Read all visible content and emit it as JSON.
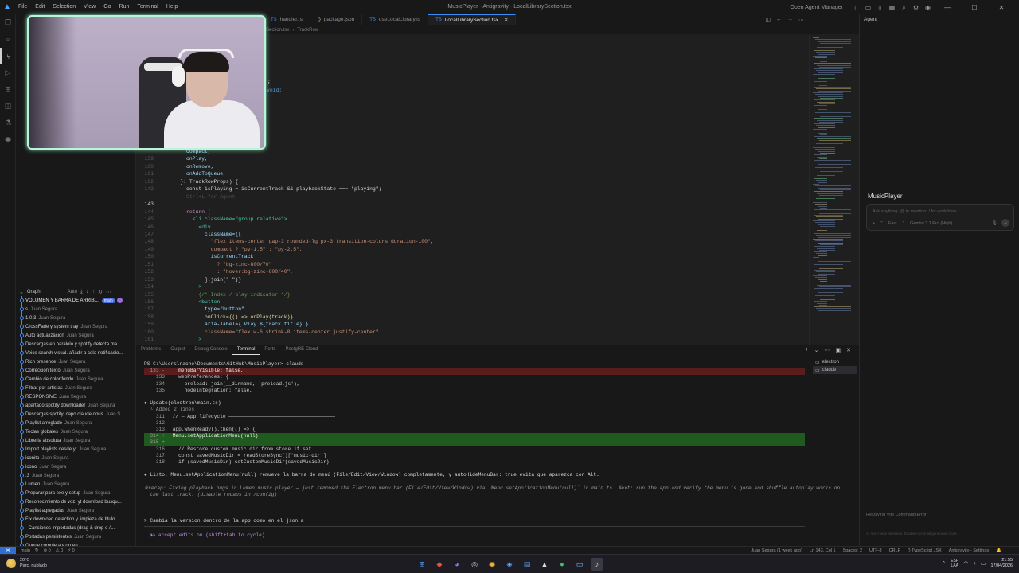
{
  "window": {
    "title": "MusicPlayer - Antigravity - LocalLibrarySection.tsx",
    "menu": [
      "File",
      "Edit",
      "Selection",
      "View",
      "Go",
      "Run",
      "Terminal",
      "Help"
    ],
    "open_agent_manager": "Open Agent Manager"
  },
  "tabs": [
    {
      "label": "handler.ts",
      "icon": "ts-icon",
      "active": false
    },
    {
      "label": "package.json",
      "icon": "json-icon",
      "active": false
    },
    {
      "label": "useLocalLibrary.ts",
      "icon": "ts-icon",
      "active": false
    },
    {
      "label": "LocalLibrarySection.tsx",
      "icon": "tsx-icon",
      "active": true
    }
  ],
  "breadcrumb": {
    "file": "ySection.tsx",
    "symbol": "TrackRow"
  },
  "editor": {
    "lines": [
      {
        "n": "",
        "t": "compact,",
        "cls": "tk-var",
        "indent": 6
      },
      {
        "n": "159",
        "t": "onPlay,",
        "cls": "tk-var",
        "indent": 6
      },
      {
        "n": "160",
        "t": "onRemove,",
        "cls": "tk-var",
        "indent": 6
      },
      {
        "n": "161",
        "t": "onAddToQueue,",
        "cls": "tk-var",
        "indent": 6
      },
      {
        "n": "162",
        "t": "}: TrackRowProps) {",
        "cls": "tk-txt",
        "indent": 4
      },
      {
        "n": "142",
        "t": "const isPlaying = isCurrentTrack && playbackState === \"playing\";",
        "cls": "tk-txt",
        "indent": 6
      },
      {
        "n": "",
        "t": "Ctrl+L for Agent",
        "cls": "tk-hint",
        "indent": 6
      },
      {
        "n": "143",
        "t": "",
        "cls": "tk-txt",
        "indent": 6,
        "cur": true
      },
      {
        "n": "144",
        "t": "return (",
        "cls": "tk-kw",
        "indent": 6
      },
      {
        "n": "145",
        "t": "<li className=\"group relative\">",
        "cls": "tk-tag",
        "indent": 8
      },
      {
        "n": "146",
        "t": "<div",
        "cls": "tk-tag",
        "indent": 10
      },
      {
        "n": "147",
        "t": "className={[",
        "cls": "tk-var",
        "indent": 12
      },
      {
        "n": "148",
        "t": "\"flex items-center gap-3 rounded-lg px-3 transition-colors duration-100\",",
        "cls": "tk-str",
        "indent": 14
      },
      {
        "n": "149",
        "t": "compact ? \"py-1.5\" : \"py-2.5\",",
        "cls": "tk-str",
        "indent": 14
      },
      {
        "n": "150",
        "t": "isCurrentTrack",
        "cls": "tk-var",
        "indent": 14
      },
      {
        "n": "151",
        "t": "? \"bg-zinc-800/70\"",
        "cls": "tk-str",
        "indent": 16
      },
      {
        "n": "152",
        "t": ": \"hover:bg-zinc-800/40\",",
        "cls": "tk-str",
        "indent": 16
      },
      {
        "n": "153",
        "t": "].join(\" \")}",
        "cls": "tk-txt",
        "indent": 12
      },
      {
        "n": "154",
        "t": ">",
        "cls": "tk-tag",
        "indent": 10
      },
      {
        "n": "155",
        "t": "{/* Index / play indicator */}",
        "cls": "tk-com",
        "indent": 10
      },
      {
        "n": "156",
        "t": "<button",
        "cls": "tk-tag",
        "indent": 10
      },
      {
        "n": "157",
        "t": "type=\"button\"",
        "cls": "tk-var",
        "indent": 12
      },
      {
        "n": "158",
        "t": "onClick={() => onPlay(track)}",
        "cls": "tk-fn",
        "indent": 12
      },
      {
        "n": "159",
        "t": "aria-label={`Play ${track.title}`}",
        "cls": "tk-var",
        "indent": 12
      },
      {
        "n": "160",
        "t": "className=\"flex w-6 shrink-0 items-center justify-center\"",
        "cls": "tk-str",
        "indent": 12
      },
      {
        "n": "161",
        "t": ">",
        "cls": "tk-tag",
        "indent": 10
      },
      {
        "n": "162",
        "t": "{isCurrentTrack ? (",
        "cls": "tk-txt",
        "indent": 12
      }
    ],
    "partial_top": [
      ";",
      "void;"
    ]
  },
  "sidebar": {
    "graph_title": "Graph",
    "graph_mode": "Auto",
    "commits": [
      {
        "msg": "VOLUMEN Y BARRA DE ARRIB...",
        "auth": "",
        "badge": "main"
      },
      {
        "msg": "s",
        "auth": "Juan Segura"
      },
      {
        "msg": "1.0.3",
        "auth": "Juan Segura"
      },
      {
        "msg": "CrossFade y system tray",
        "auth": "Juan Segura"
      },
      {
        "msg": "Auto actualizacion",
        "auth": "Juan Segura"
      },
      {
        "msg": "Descargas en paralelo y spotify detecta ma...",
        "auth": ""
      },
      {
        "msg": "Voice search visual. añadir a cola notificacio...",
        "auth": ""
      },
      {
        "msg": "Rich presence",
        "auth": "Juan Segura"
      },
      {
        "msg": "Correccion texto",
        "auth": "Juan Segura"
      },
      {
        "msg": "Cambio de color fondo",
        "auth": "Juan Segura"
      },
      {
        "msg": "Filtrar por artistas",
        "auth": "Juan Segura"
      },
      {
        "msg": "RESPONSIVE",
        "auth": "Juan Segura"
      },
      {
        "msg": "apartado spotify downloader",
        "auth": "Juan Segura"
      },
      {
        "msg": "Descargas spotify, capo claude opus",
        "auth": "Juan S..."
      },
      {
        "msg": "Playlist arreglado",
        "auth": "Juan Segura"
      },
      {
        "msg": "Teclas globales",
        "auth": "Juan Segura"
      },
      {
        "msg": "Libreria absoluta",
        "auth": "Juan Segura"
      },
      {
        "msg": "Import playlists desde yt",
        "auth": "Juan Segura"
      },
      {
        "msg": "iconito",
        "auth": "Juan Segura"
      },
      {
        "msg": "icono",
        "auth": "Juan Segura"
      },
      {
        "msg": ":3",
        "auth": "Juan Segura"
      },
      {
        "msg": "Lumen",
        "auth": "Juan Segura"
      },
      {
        "msg": "Preparar para exe y setup",
        "auth": "Juan Segura"
      },
      {
        "msg": "Reconocimiento de voz, yt download busqu...",
        "auth": ""
      },
      {
        "msg": "Playlist agregadas",
        "auth": "Juan Segura"
      },
      {
        "msg": "Fix download detection y limpieza de titulo...",
        "auth": ""
      },
      {
        "msg": "- Canciones importadas (drag & drop o A...",
        "auth": ""
      },
      {
        "msg": "Portadas persistentes",
        "auth": "Juan Segura"
      },
      {
        "msg": "Queue completa y orden ...",
        "auth": ""
      }
    ]
  },
  "panel": {
    "tabs": [
      "Problems",
      "Output",
      "Debug Console",
      "Terminal",
      "Ports",
      "PostgRE Cloud"
    ],
    "active_tab": "Terminal",
    "terminals": [
      "electron",
      "claude"
    ],
    "lines": [
      {
        "kind": "cmd",
        "n": "",
        "t": "PS C:\\Users\\nacho\\Documents\\GitHub\\MusicPlayer> claude"
      },
      {
        "kind": "del",
        "n": "133 -",
        "t": "   menuBarVisible: false,"
      },
      {
        "kind": "ctx",
        "n": "133",
        "t": "   webPreferences: {"
      },
      {
        "kind": "ctx",
        "n": "134",
        "t": "     preload: join(__dirname, 'preload.js'),"
      },
      {
        "kind": "ctx",
        "n": "135",
        "t": "     nodeIntegration: false,"
      },
      {
        "kind": "blank",
        "n": "",
        "t": ""
      },
      {
        "kind": "head",
        "n": "",
        "t": "● Update(electron\\main.ts)"
      },
      {
        "kind": "sub",
        "n": "",
        "t": "  └ Added 2 lines"
      },
      {
        "kind": "ctx",
        "n": "311",
        "t": " // — App lifecycle ————————————————————————————————————"
      },
      {
        "kind": "ctx",
        "n": "312",
        "t": ""
      },
      {
        "kind": "ctx",
        "n": "313",
        "t": " app.whenReady().then(() => {"
      },
      {
        "kind": "add",
        "n": "314 +",
        "t": " Menu.setApplicationMenu(null)"
      },
      {
        "kind": "add",
        "n": "315 +",
        "t": ""
      },
      {
        "kind": "ctx",
        "n": "316",
        "t": "   // Restore custom music dir from store if set"
      },
      {
        "kind": "ctx",
        "n": "317",
        "t": "   const savedMusicDir = readStoreSync()['music-dir']"
      },
      {
        "kind": "ctx",
        "n": "318",
        "t": "   if (savedMusicDir) setCustomMusicDir(savedMusicDir)"
      },
      {
        "kind": "blank",
        "n": "",
        "t": ""
      },
      {
        "kind": "head",
        "n": "",
        "t": "● Listo. Menu.setApplicationMenu(null) remueve la barra de menú (File/Edit/View/Window) completamente, y autoHideMenuBar: true evita que aparezca con Alt."
      },
      {
        "kind": "blank",
        "n": "",
        "t": ""
      },
      {
        "kind": "recap",
        "n": "",
        "t": "※recap: Fixing playback bugs in Lumen music player — just removed the Electron menu bar (File/Edit/View/Window) via `Menu.setApplicationMenu(null)` in main.ts. Next: run the app and verify the menu is gone and shuffle autoplay works on"
      },
      {
        "kind": "recap",
        "n": "",
        "t": "  the last track. (disable recaps in /config)"
      }
    ],
    "prompt": "> Cambia la version dentro de la app como en el json a",
    "accept": "⏵⏵ accept edits on (shift+tab to cycle)"
  },
  "agent": {
    "header": "Agent",
    "title": "MusicPlayer",
    "placeholder": "Ask anything, @ to mention, / for workflows",
    "add": "+",
    "mode": "Fast",
    "model": "Gemini 3.1 Pro (High)",
    "status": "Resolving Vite Command Error",
    "status2": "AI may make mistakes. Double-check all generated code."
  },
  "statusbar": {
    "branch": "main",
    "errors": "⊗ 0",
    "warnings": "⚠ 0",
    "ports": "⚡ 0",
    "user": "Juan Segura (1 week ago)",
    "position": "Ln 143, Col 1",
    "spaces": "Spaces: 2",
    "encoding": "UTF-8",
    "eol": "CRLF",
    "lang": "{} TypeScript JSX",
    "ag": "Antigravity - Settings"
  },
  "taskbar": {
    "temp": "20°C",
    "weather": "Parc. nublado",
    "lang1": "ESP",
    "lang2": "LAA",
    "time": "21:55",
    "date": "17/04/2026"
  }
}
